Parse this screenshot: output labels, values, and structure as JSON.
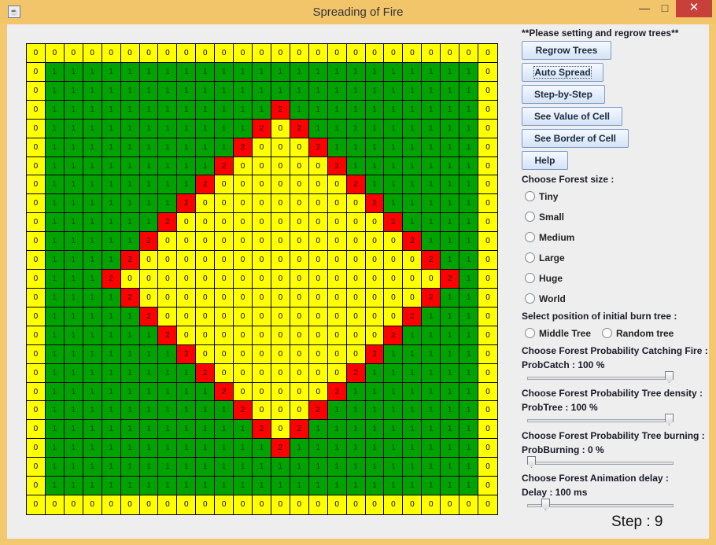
{
  "window": {
    "title": "Spreading of Fire",
    "app_icon": "java-cup-icon",
    "controls": {
      "minimize": "—",
      "maximize": "□",
      "close": "✕"
    }
  },
  "grid": {
    "size": 25,
    "colors": {
      "0": "#ffff00",
      "1": "#00a300",
      "2": "#ff0000"
    },
    "rows": [
      "0000000000000000000000000",
      "0111111111111111111111110",
      "0111111111111111111111110",
      "0111111111111211111111110",
      "0111111111112021111111110",
      "0111111111120002111111110",
      "0111111111200000211111110",
      "0111111112000000021111110",
      "0111111120000000002111110",
      "0111111200000000000211110",
      "0111112000000000000021110",
      "0111120000000000000002110",
      "0111200000000000000000210",
      "0111120000000000000002110",
      "0111112000000000000021110",
      "0111111200000000000211110",
      "0111111120000000002111110",
      "0111111112000000021111110",
      "0111111111200000211111110",
      "0111111111120002111111110",
      "0111111111112021111111110",
      "0111111111111211111111110",
      "0111111111111111111111110",
      "0111111111111111111111110",
      "0000000000000000000000000"
    ]
  },
  "panel": {
    "note": "**Please setting and regrow trees**",
    "buttons": {
      "regrow": "Regrow Trees",
      "auto": "Auto Spread",
      "step": "Step-by-Step",
      "value": "See Value of Cell",
      "border": "See Border of Cell",
      "help": "Help"
    },
    "forest_size": {
      "label": "Choose Forest size :",
      "options": [
        "Tiny",
        "Small",
        "Medium",
        "Large",
        "Huge",
        "World"
      ]
    },
    "position": {
      "label": "Select position of initial burn tree :",
      "options": [
        "Middle Tree",
        "Random tree"
      ]
    },
    "catch": {
      "label": "Choose Forest Probability Catching Fire :",
      "value_text": "ProbCatch : 100 %",
      "value": 100,
      "max": 100
    },
    "density": {
      "label": "Choose Forest Probability Tree density :",
      "value_text": "ProbTree : 100 %",
      "value": 100,
      "max": 100
    },
    "burning": {
      "label": "Choose Forest Probability Tree burning :",
      "value_text": "ProbBurning : 0 %",
      "value": 0,
      "max": 100
    },
    "delay": {
      "label": "Choose Forest Animation delay :",
      "value_text": "Delay : 100 ms",
      "value": 100,
      "max": 1000
    },
    "step": "Step : 9"
  }
}
